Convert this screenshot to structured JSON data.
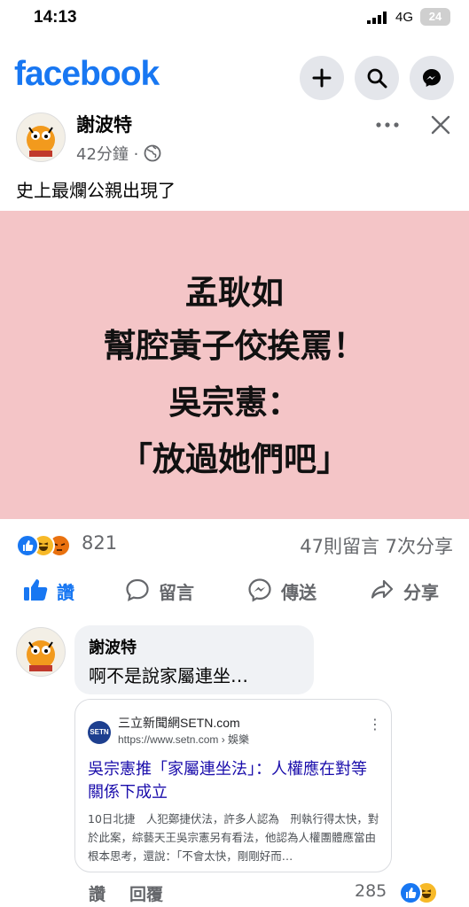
{
  "status_bar": {
    "time": "14:13",
    "network": "4G",
    "battery": "24"
  },
  "header": {
    "logo": "facebook",
    "buttons": [
      "create-post",
      "search",
      "messenger"
    ]
  },
  "post": {
    "author": "謝波特",
    "time": "42分鐘",
    "audience_icon": "globe-icon",
    "text": "史上最爛公親出現了",
    "image_lines": [
      "孟耿如",
      "幫腔黃子佼挨罵！",
      "吳宗憲：",
      "「放過她們吧」"
    ],
    "reaction_count": "821",
    "comments_shares": "47則留言  7次分享",
    "actions": {
      "like": "讚",
      "comment": "留言",
      "send": "傳送",
      "share": "分享"
    }
  },
  "comment": {
    "author": "謝波特",
    "text": "啊不是說家屬連坐…",
    "link_card": {
      "site_name": "三立新聞網SETN.com",
      "url": "https://www.setn.com › 娛樂",
      "logo_text": "SETN",
      "title": "吳宗憲推「家屬連坐法」：人權應在對等關係下成立",
      "snippet": "10日北捷　人犯鄭捷伏法，許多人認為　刑執行得太快，對於此案，綜藝天王吳宗憲另有看法，他認為人權團體應當由根本思考，還說：「不會太快，剛剛好而…"
    },
    "like_label": "讚",
    "reply_label": "回覆",
    "reaction_count": "285"
  },
  "colors": {
    "brand": "#1877f2",
    "image_bg": "#f4c5c7",
    "link_title": "#1a0dab"
  }
}
